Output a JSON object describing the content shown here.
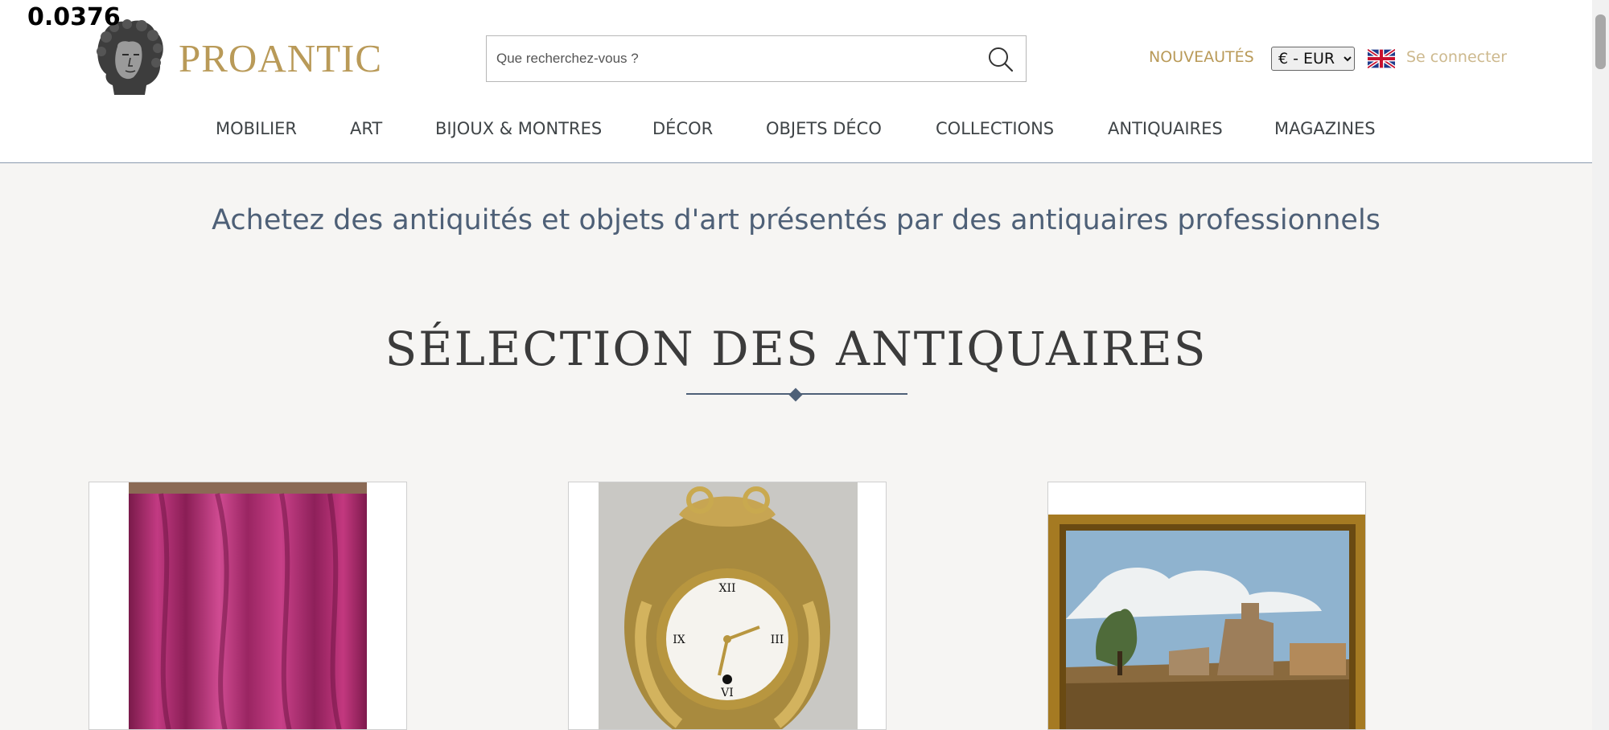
{
  "overlay": {
    "value": "0.0376"
  },
  "brand": {
    "name": "PROANTIC"
  },
  "search": {
    "placeholder": "Que recherchez-vous ?"
  },
  "header": {
    "nouveautes_label": "NOUVEAUTÉS",
    "currency_selected": "€ - EUR",
    "login_label": "Se connecter"
  },
  "nav": {
    "items": [
      {
        "label": "MOBILIER"
      },
      {
        "label": "ART"
      },
      {
        "label": "BIJOUX & MONTRES"
      },
      {
        "label": "DÉCOR"
      },
      {
        "label": "OBJETS DÉCO"
      },
      {
        "label": "COLLECTIONS"
      },
      {
        "label": "ANTIQUAIRES"
      },
      {
        "label": "MAGAZINES"
      }
    ]
  },
  "main": {
    "tagline": "Achetez des antiquités et objets d'art présentés par des antiquaires professionnels",
    "section_title": "SÉLECTION DES ANTIQUAIRES"
  },
  "icons": {
    "search": "search-icon",
    "flag": "uk-flag-icon",
    "logo": "bust-logo-icon",
    "chevron": "chevron-down-icon"
  },
  "colors": {
    "brand_gold": "#b99a58",
    "login_gold": "#cdb98e",
    "accent_blue": "#4e6077",
    "page_background": "#f6f5f3"
  }
}
